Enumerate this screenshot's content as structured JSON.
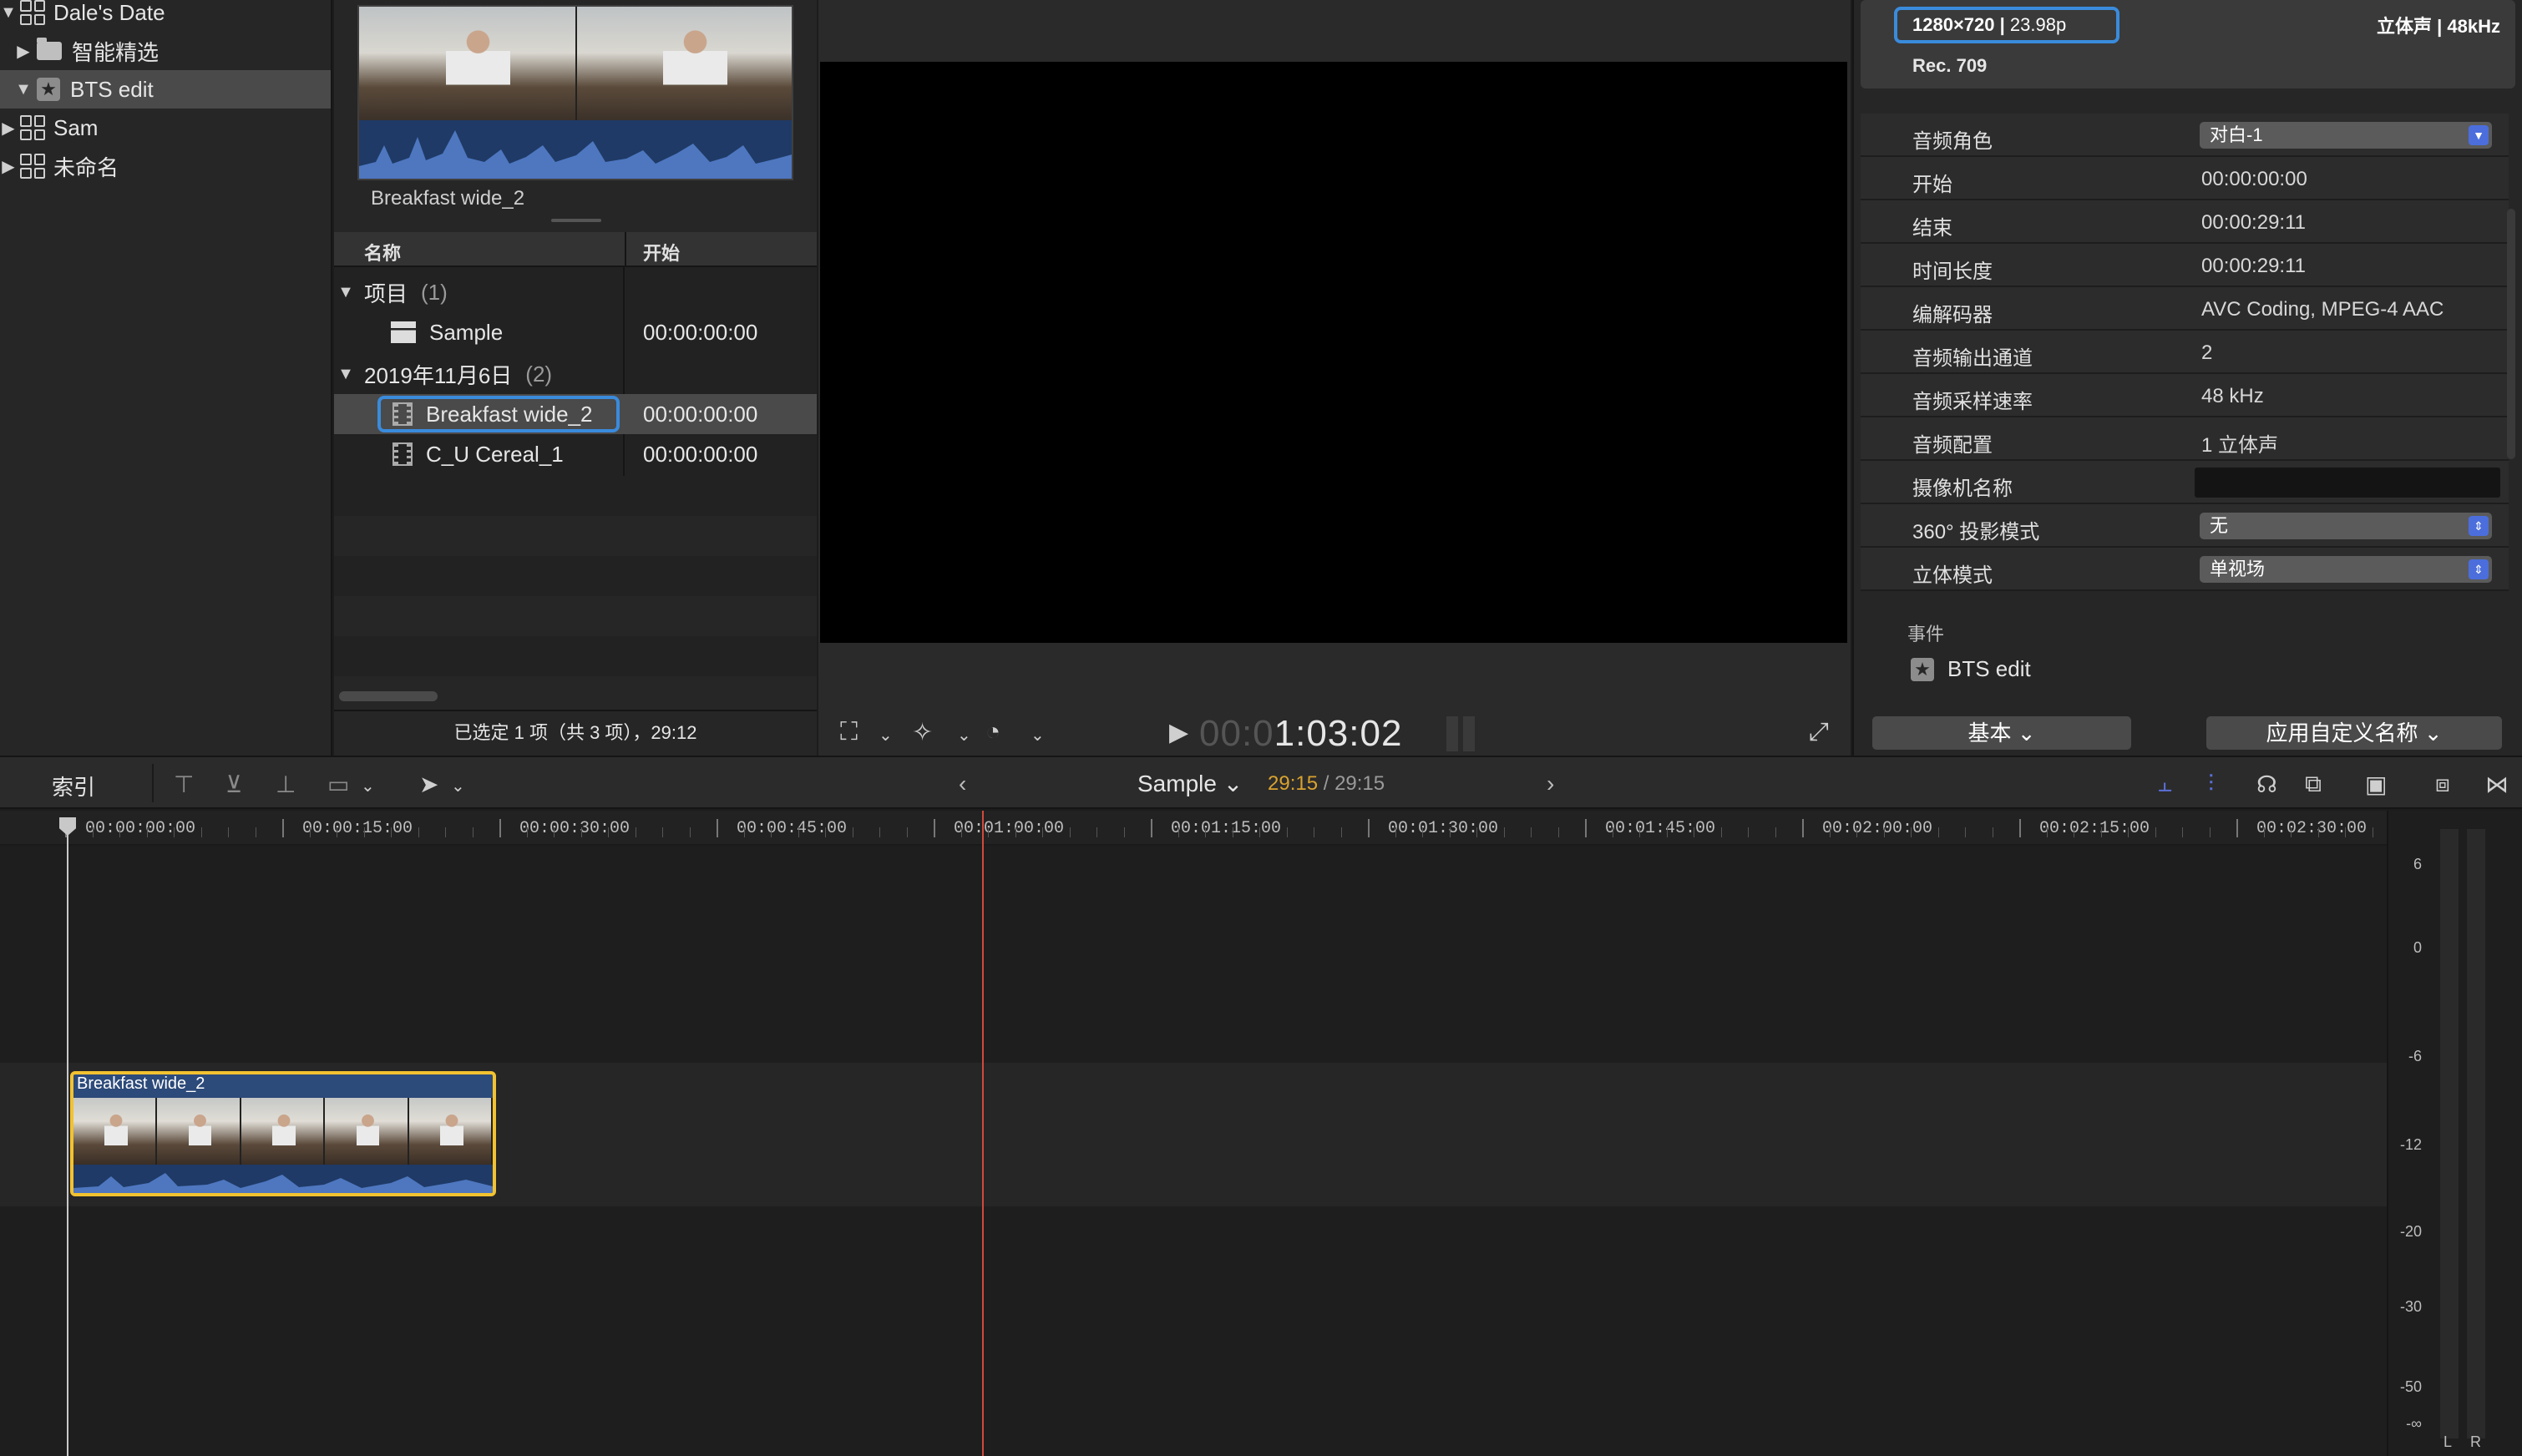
{
  "library": {
    "items": [
      {
        "name": "Dale's Date",
        "expanded": true,
        "icon": "library-grid-icon"
      },
      {
        "name": "智能精选",
        "expanded": false,
        "icon": "folder-icon"
      },
      {
        "name": "BTS edit",
        "expanded": true,
        "icon": "event-star-icon",
        "selected": true
      },
      {
        "name": "Sam",
        "expanded": false,
        "icon": "library-grid-icon"
      },
      {
        "name": "未命名",
        "expanded": false,
        "icon": "library-grid-icon"
      }
    ]
  },
  "browser": {
    "thumb_label": "Breakfast wide_2",
    "columns": [
      "名称",
      "开始"
    ],
    "groups": [
      {
        "title": "项目",
        "count": "(1)",
        "items": [
          {
            "name": "Sample",
            "start": "00:00:00:00",
            "icon": "project-clapper-icon"
          }
        ]
      },
      {
        "title": "2019年11月6日",
        "count": "(2)",
        "items": [
          {
            "name": "Breakfast wide_2",
            "start": "00:00:00:00",
            "icon": "clip-film-icon",
            "selected": true
          },
          {
            "name": "C_U Cereal_1",
            "start": "00:00:00:00",
            "icon": "clip-film-icon"
          }
        ]
      }
    ],
    "status": "已选定 1 项（共 3 项），29:12"
  },
  "viewer": {
    "timecode_dim": "00:0",
    "timecode": "1:03:02"
  },
  "inspector": {
    "resolution": "1280×720",
    "framerate": "23.98p",
    "audio": "立体声",
    "sample_rate": "48kHz",
    "color_space": "Rec. 709",
    "properties": [
      {
        "key": "音频角色",
        "value": "对白-1",
        "type": "select"
      },
      {
        "key": "开始",
        "value": "00:00:00:00"
      },
      {
        "key": "结束",
        "value": "00:00:29:11"
      },
      {
        "key": "时间长度",
        "value": "00:00:29:11"
      },
      {
        "key": "编解码器",
        "value": "AVC Coding, MPEG-4 AAC"
      },
      {
        "key": "音频输出通道",
        "value": "2"
      },
      {
        "key": "音频采样速率",
        "value": "48 kHz"
      },
      {
        "key": "音频配置",
        "value": "1 立体声"
      },
      {
        "key": "摄像机名称",
        "value": "",
        "type": "field"
      },
      {
        "key": "360° 投影模式",
        "value": "无",
        "type": "stepper"
      },
      {
        "key": "立体模式",
        "value": "单视场",
        "type": "stepper"
      }
    ],
    "event_heading": "事件",
    "event_name": "BTS edit",
    "basic_button": "基本",
    "apply_button": "应用自定义名称"
  },
  "toolbar": {
    "index": "索引",
    "project": "Sample",
    "position": "29:15",
    "duration": "/ 29:15"
  },
  "timeline": {
    "ruler": [
      "00:00:00:00",
      "00:00:15:00",
      "00:00:30:00",
      "00:00:45:00",
      "00:01:00:00",
      "00:01:15:00",
      "00:01:30:00",
      "00:01:45:00",
      "00:02:00:00",
      "00:02:15:00",
      "00:02:30:00"
    ],
    "clip_name": "Breakfast wide_2"
  },
  "meters": {
    "scale": [
      "6",
      "0",
      "-6",
      "-12",
      "-20",
      "-30",
      "-50",
      "-∞"
    ],
    "left": "L",
    "right": "R"
  },
  "colors": {
    "selection_blue": "#3a8bdc",
    "clip_border": "#f2c230",
    "playhead_red": "#d14a3a",
    "audio_wave": "#1f3a66",
    "duration_highlight": "#d9a22f"
  }
}
